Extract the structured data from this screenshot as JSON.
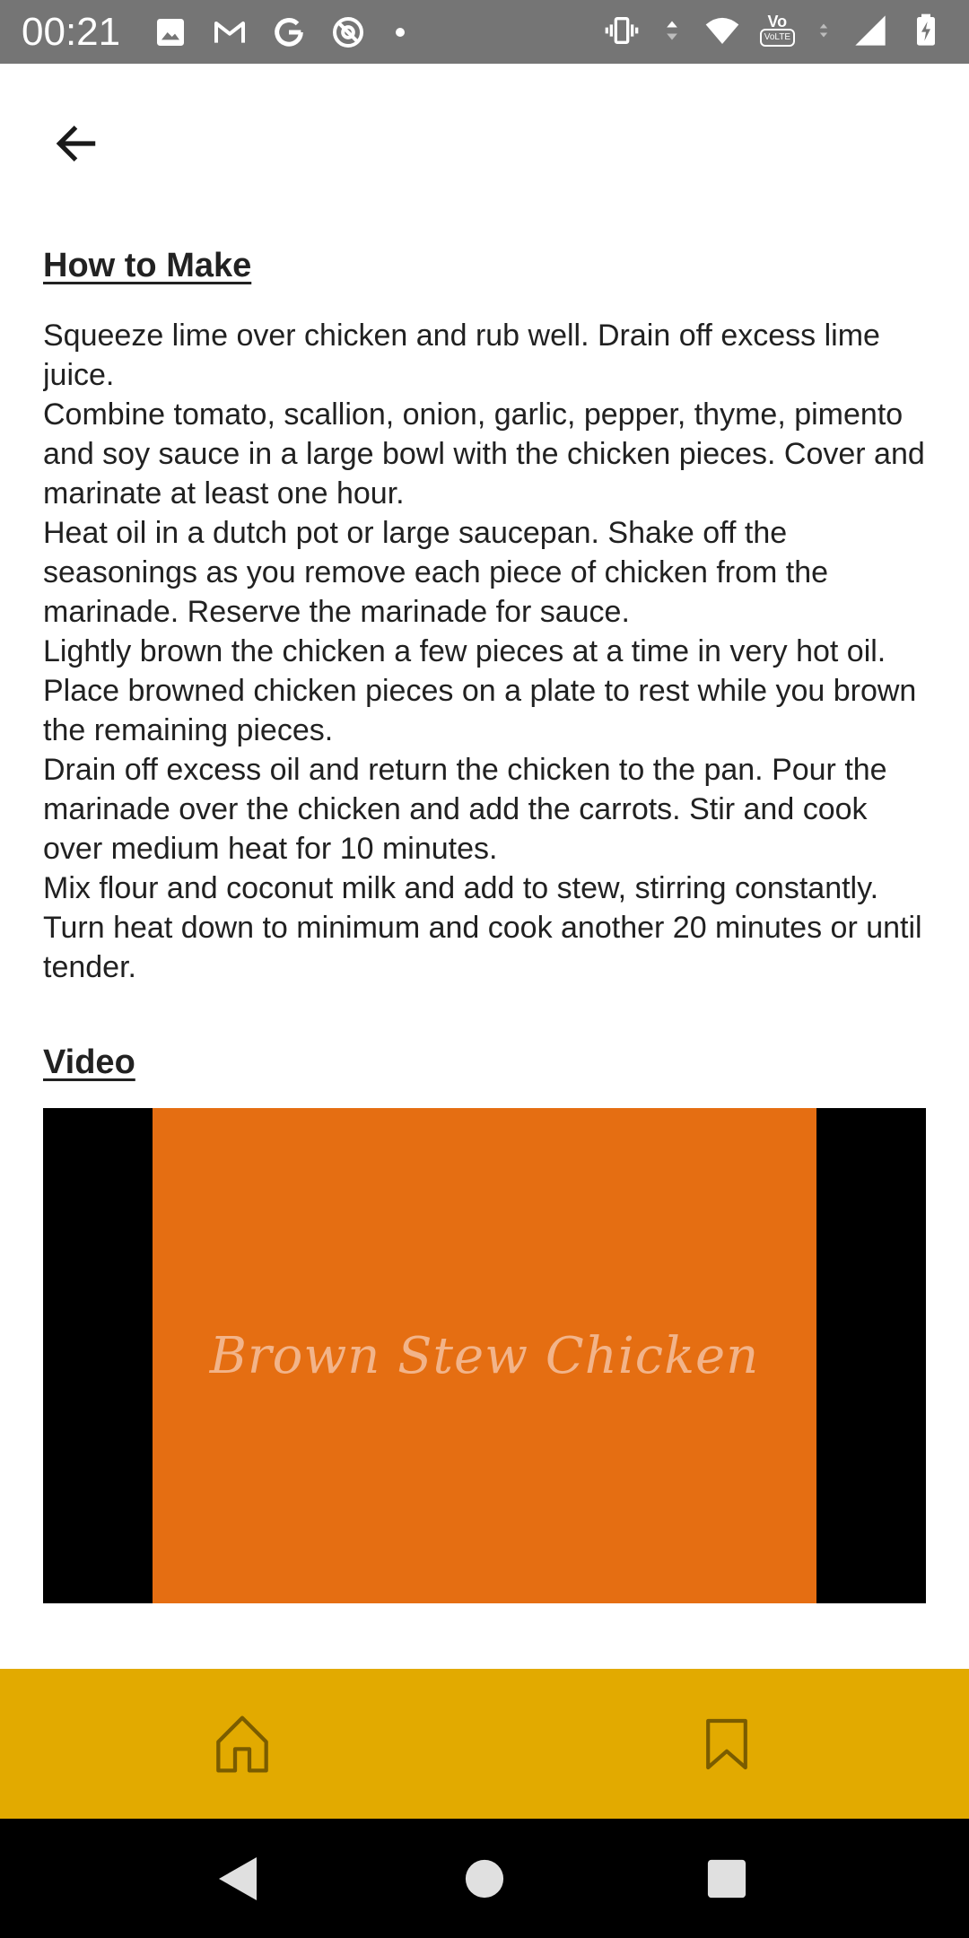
{
  "status_bar": {
    "time": "00:21",
    "icons_left": [
      "image-icon",
      "gmail-icon",
      "google-icon",
      "at-sign-icon",
      "dot-icon"
    ],
    "icons_right": [
      "vibrate-icon",
      "data-arrows-icon",
      "wifi-icon",
      "volte-icon",
      "signal-icon",
      "battery-charging-icon"
    ],
    "volte_label": "VoLTE"
  },
  "header": {
    "back_icon": "arrow-back-icon"
  },
  "how_to_make": {
    "heading": "How to Make",
    "steps": [
      "Squeeze lime over chicken and rub well. Drain off excess lime juice.",
      "Combine tomato, scallion, onion, garlic, pepper, thyme, pimento and soy sauce in a large bowl with the chicken pieces. Cover and marinate at least one hour.",
      "Heat oil in a dutch pot or large saucepan. Shake off the seasonings as you remove each piece of chicken from the marinade. Reserve the marinade for sauce.",
      "Lightly brown the chicken a few pieces at a time in very hot oil. Place browned chicken pieces on a plate to rest while you brown the remaining pieces.",
      "Drain off excess oil and return the chicken to the pan. Pour the marinade over the chicken and add the carrots. Stir and cook over medium heat for 10 minutes.",
      "Mix flour and coconut milk and add to stew, stirring constantly. Turn heat down to minimum and cook another 20 minutes or until tender."
    ]
  },
  "video": {
    "heading": "Video",
    "title": "Brown Stew Chicken",
    "frame_color": "#e56e12",
    "letterbox_color": "#000000"
  },
  "bottom_nav": {
    "background": "#e2aa00",
    "items": [
      "home-icon",
      "bookmark-icon"
    ]
  },
  "system_nav": {
    "items": [
      "back-triangle-icon",
      "home-circle-icon",
      "recents-square-icon"
    ]
  }
}
